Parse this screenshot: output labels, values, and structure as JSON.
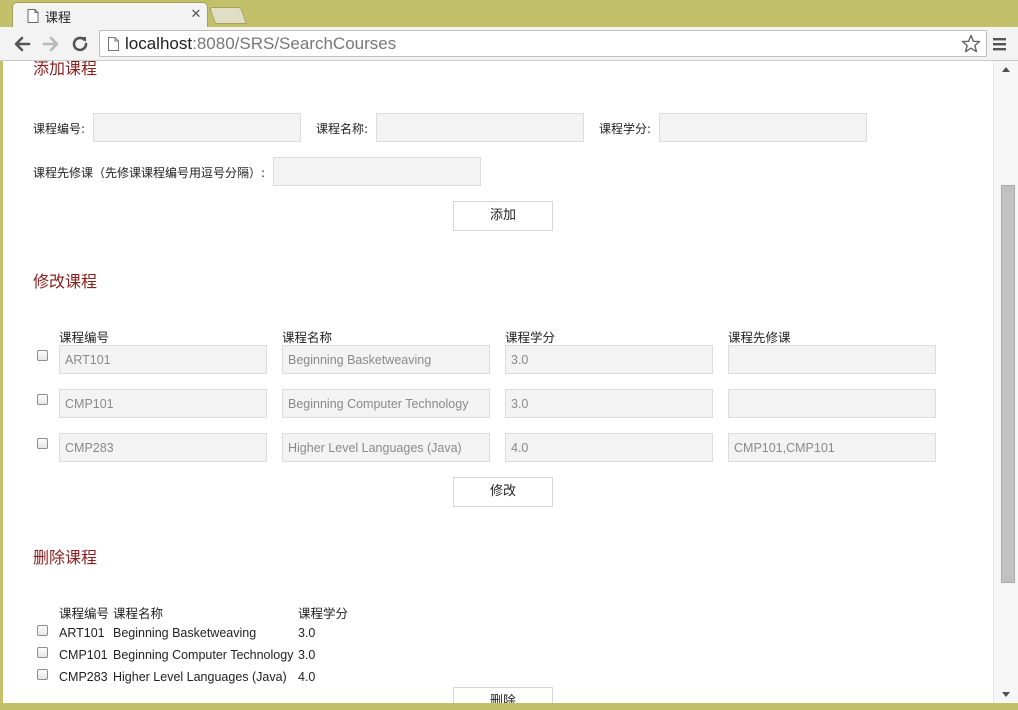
{
  "browser": {
    "tab_title": "课程",
    "url_host": "localhost",
    "url_rest": ":8080/SRS/SearchCourses",
    "accent_color": "#c2c06b"
  },
  "add_section": {
    "title": "添加课程",
    "course_no_label": "课程编号:",
    "course_name_label": "课程名称:",
    "credits_label": "课程学分:",
    "prereq_label": "课程先修课（先修课课程编号用逗号分隔）:",
    "course_no_value": "",
    "course_name_value": "",
    "credits_value": "",
    "prereq_value": "",
    "button_label": "添加"
  },
  "modify_section": {
    "title": "修改课程",
    "headers": [
      "课程编号",
      "课程名称",
      "课程学分",
      "课程先修课"
    ],
    "rows": [
      {
        "no": "ART101",
        "name": "Beginning Basketweaving",
        "credits": "3.0",
        "prereq": ""
      },
      {
        "no": "CMP101",
        "name": "Beginning Computer Technology",
        "credits": "3.0",
        "prereq": ""
      },
      {
        "no": "CMP283",
        "name": "Higher Level Languages (Java)",
        "credits": "4.0",
        "prereq": "CMP101,CMP101"
      }
    ],
    "button_label": "修改"
  },
  "delete_section": {
    "title": "删除课程",
    "headers": [
      "课程编号",
      "课程名称",
      "课程学分"
    ],
    "rows": [
      {
        "no": "ART101",
        "name": "Beginning Basketweaving",
        "credits": "3.0"
      },
      {
        "no": "CMP101",
        "name": "Beginning Computer Technology",
        "credits": "3.0"
      },
      {
        "no": "CMP283",
        "name": "Higher Level Languages (Java)",
        "credits": "4.0"
      }
    ],
    "button_label": "删除"
  }
}
